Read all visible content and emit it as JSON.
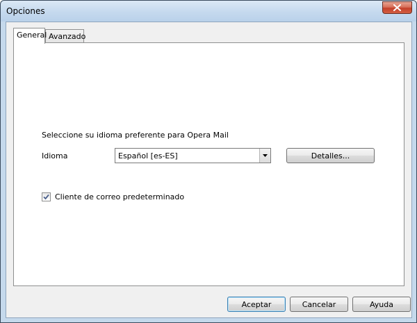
{
  "window": {
    "title": "Opciones"
  },
  "tabs": [
    {
      "label": "General",
      "active": true
    },
    {
      "label": "Avanzado",
      "active": false
    }
  ],
  "general": {
    "prompt": "Seleccione su idioma preferente para Opera Mail",
    "language_label": "Idioma",
    "language_value": "Español [es-ES]",
    "details_button": "Detalles...",
    "default_client_label": "Cliente de correo predeterminado",
    "default_client_checked": true
  },
  "footer": {
    "accept": "Aceptar",
    "cancel": "Cancelar",
    "help": "Ayuda"
  },
  "colors": {
    "accent": "#3c7fb1",
    "close_button": "#c4402a",
    "titlebar": "#c5d9ee"
  }
}
